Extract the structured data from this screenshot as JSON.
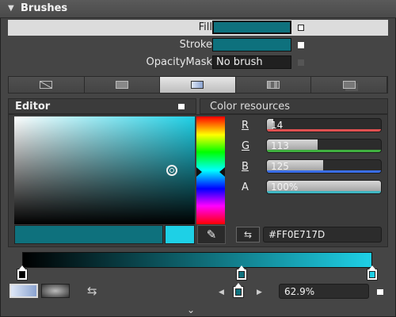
{
  "header": {
    "title": "Brushes",
    "collapse_icon": "triangle-down-icon"
  },
  "properties": [
    {
      "label": "Fill",
      "value": "",
      "color": "#0E717D",
      "selected": true
    },
    {
      "label": "Stroke",
      "value": "",
      "color": "#0E717D",
      "selected": false
    },
    {
      "label": "OpacityMask",
      "value": "No brush",
      "color": "#000000",
      "selected": false
    }
  ],
  "brush_tabs": [
    "no-brush-icon",
    "solid-brush-icon",
    "gradient-brush-icon",
    "tile-brush-icon",
    "resource-brush-icon"
  ],
  "selected_brush_tab": 2,
  "sections": {
    "editor": "Editor",
    "color_resources": "Color resources"
  },
  "channels": [
    {
      "label": "R",
      "value": "14",
      "fraction": 0.055,
      "bar": "#e05050"
    },
    {
      "label": "G",
      "value": "113",
      "fraction": 0.443,
      "bar": "#40b040"
    },
    {
      "label": "B",
      "value": "125",
      "fraction": 0.49,
      "bar": "#3a6ee8"
    },
    {
      "label": "A",
      "value": "100%",
      "fraction": 1.0,
      "bar": "#3fb6c2"
    }
  ],
  "hex": {
    "value": "#FF0E717D",
    "swap_icon": "swap-icon"
  },
  "colors": {
    "current": "#0E717D",
    "new": "#1ED0E6",
    "gradient_start": "#000000",
    "gradient_end": "#1ED0E6"
  },
  "gradient": {
    "selected_stop_offset": "62.9%"
  },
  "dropper_icon": "eyedropper-icon",
  "expand_icon": "chevron-down-icon"
}
